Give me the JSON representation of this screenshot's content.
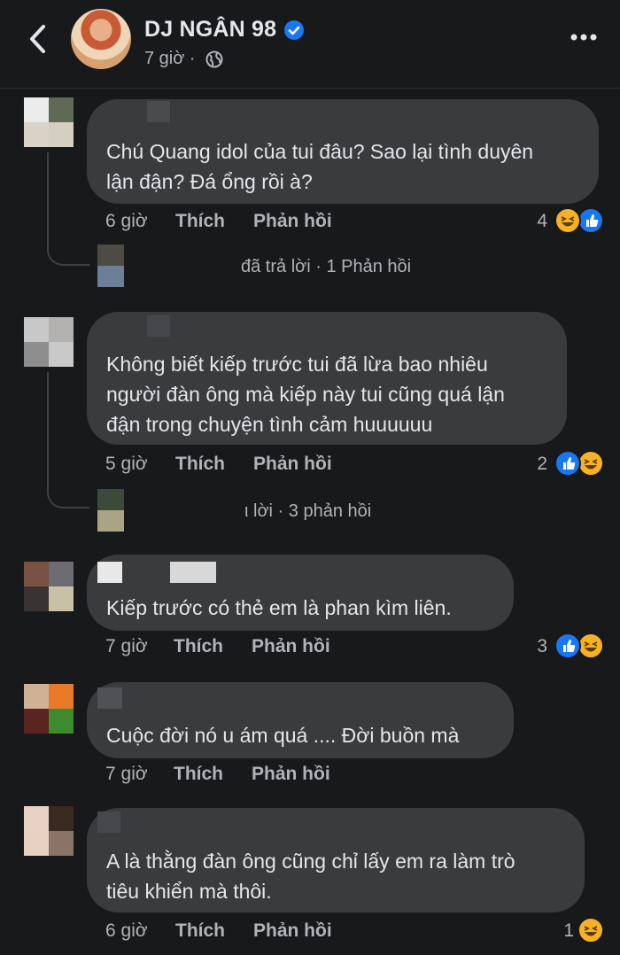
{
  "header": {
    "page_name": "DJ NGÂN 98",
    "post_time": "7 giờ ·",
    "back_icon": "chevron-left-icon",
    "verified_icon": "verified-badge-icon",
    "privacy_icon": "globe-icon",
    "more_icon": "more-horizontal-icon"
  },
  "comments": [
    {
      "text": "Chú Quang idol của tui đâu? Sao lại tình duyên\nlận đận? Đá ổng rồi à?",
      "time": "6 giờ",
      "like_label": "Thích",
      "reply_label": "Phản hồi",
      "reaction_count": "4",
      "reply_summary": "đã trả lời · 1 Phản hồi"
    },
    {
      "text": "Không biết kiếp trước tui đã lừa bao nhiêu\nngười đàn ông mà kiếp này tui cũng quá lận\nđận trong chuyện tình cảm huuuuuu",
      "time": "5 giờ",
      "like_label": "Thích",
      "reply_label": "Phản hồi",
      "reaction_count": "2",
      "reply_summary": "ι lời · 3 phản hồi"
    },
    {
      "text": "Kiếp trước có thẻ em là phan kìm  liên.",
      "time": "7 giờ",
      "like_label": "Thích",
      "reply_label": "Phản hồi",
      "reaction_count": "3"
    },
    {
      "text": "Cuộc đời nó u ám quá .... Đời buồn mà",
      "time": "7 giờ",
      "like_label": "Thích",
      "reply_label": "Phản hồi"
    },
    {
      "text": "A là thằng đàn ông cũng chỉ lấy em ra làm trò\ntiêu khiển mà thôi.",
      "time": "6 giờ",
      "like_label": "Thích",
      "reply_label": "Phản hồi",
      "reaction_count": "1"
    }
  ],
  "reaction_icons": [
    "like-reaction-icon",
    "haha-reaction-icon"
  ],
  "colors": {
    "background": "#18191a",
    "bubble": "#3a3b3c",
    "text_primary": "#e4e6eb",
    "text_secondary": "#b0b3b8",
    "like_blue": "#1877f2",
    "haha_yellow": "#f7b125"
  }
}
